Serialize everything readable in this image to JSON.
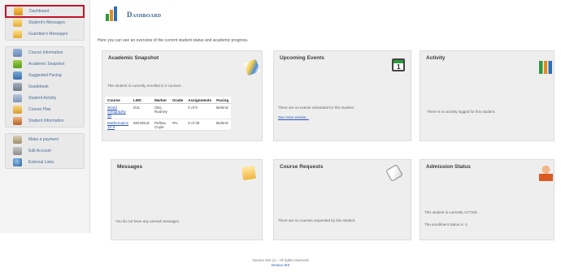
{
  "sidebar": {
    "group1": [
      {
        "label": "Dashboard",
        "icon": "home-icon"
      },
      {
        "label": "Student's Messages",
        "icon": "mail-icon"
      },
      {
        "label": "Guardian's Messages",
        "icon": "mail-icon"
      }
    ],
    "group2": [
      {
        "label": "Course Information",
        "icon": "book-icon"
      },
      {
        "label": "Academic Snapshot",
        "icon": "chart-icon"
      },
      {
        "label": "Suggested Pacing",
        "icon": "pacing-icon"
      },
      {
        "label": "Gradebook",
        "icon": "gradebook-icon"
      },
      {
        "label": "Student Activity",
        "icon": "activity-icon"
      },
      {
        "label": "Course Plan",
        "icon": "plan-icon"
      },
      {
        "label": "Student Information",
        "icon": "user-icon"
      }
    ],
    "group3": [
      {
        "label": "Make a payment",
        "icon": "payment-icon"
      },
      {
        "label": "Edit Account",
        "icon": "lock-icon"
      },
      {
        "label": "External Links",
        "icon": "globe-icon"
      }
    ]
  },
  "header": {
    "title": "Dashboard",
    "intro": "Here you can see an overview of the current student status and academic progress."
  },
  "snapshot": {
    "title": "Academic Snapshot",
    "enrolled_text": "This student is currently enrolled in 2 courses:",
    "columns": [
      "Course",
      "LMS",
      "Marker",
      "Grade",
      "Assignments",
      "Pacing"
    ],
    "rows": [
      {
        "course": "World Geography 30",
        "lms": "D2L",
        "marker": "Oko, Rodney",
        "grade": "",
        "assignments": "0 of 9",
        "pacing": "Behind"
      },
      {
        "course": "Mathematics 10-3",
        "lms": "MOODLE",
        "marker": "Pellow, Coyle",
        "grade": "0%",
        "assignments": "0 of 30",
        "pacing": "Behind"
      }
    ]
  },
  "events": {
    "title": "Upcoming Events",
    "text": "There are no events scheduled for this student.",
    "link": "See more events..."
  },
  "activity": {
    "title": "Activity",
    "text": "There is no activity logged for this student."
  },
  "messages": {
    "title": "Messages",
    "text": "You do not have any unread messages."
  },
  "requests": {
    "title": "Course Requests",
    "text": "There are no courses requested by this student."
  },
  "admission": {
    "title": "Admission Status",
    "line1": "This student is currently ACTIVE.",
    "line2": "The enrollment status is -1."
  },
  "footer": {
    "line1": "Genius SIS (c) - All rights reserved",
    "line2": "Genius SIS"
  }
}
